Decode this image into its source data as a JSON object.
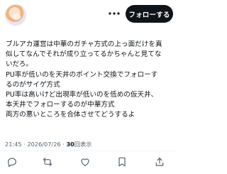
{
  "header": {
    "follow_label": "フォローする"
  },
  "tweet": {
    "lines": [
      "ブルアカ運営は中華のガチャ方式の上っ面だけを真",
      "似してなんでそれが成り立ってるかちゃんと見てな",
      "いだろ。",
      "PU率が低いのを天井のポイント交換でフォローす",
      "るのがサイゲ方式",
      "PU率は高いけど出現率が低いのを低めの仮天井、",
      "本天井でフォローするのが中華方式",
      "両方の悪いところを合体させてどうするよ"
    ]
  },
  "meta": {
    "time": "21:45",
    "separator": "·",
    "date": "2026/07/26",
    "views_count": "30",
    "views_label": "回表示"
  },
  "icons": {
    "more": "more-dots-icon",
    "reply": "reply-icon",
    "retweet": "retweet-icon",
    "like": "like-icon",
    "bookmark": "bookmark-icon",
    "share": "share-icon"
  }
}
